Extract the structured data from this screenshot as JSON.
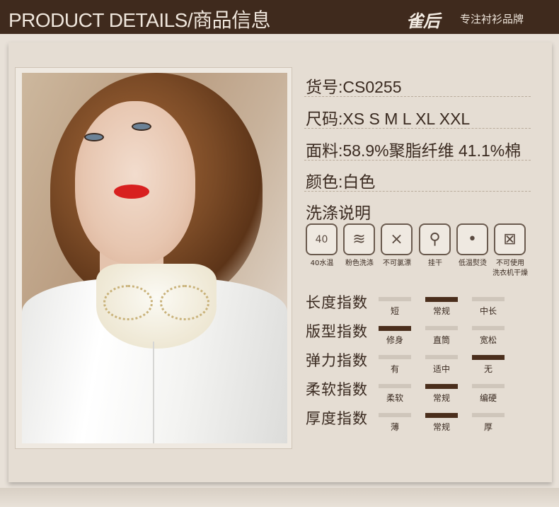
{
  "header": {
    "title": "PRODUCT DETAILS/商品信息",
    "brand": "雀后",
    "slogan": "专注衬衫品牌"
  },
  "specs": {
    "item_no": "货号:CS0255",
    "sizes": "尺码:XS S M L XL XXL",
    "fabric": "面料:58.9%聚脂纤维 41.1%棉",
    "color": "颜色:白色",
    "care_title": "洗涤说明"
  },
  "care": [
    {
      "icon": "wash-40-icon",
      "symbol": "40",
      "label": "40水温"
    },
    {
      "icon": "wash-separately-icon",
      "symbol": "≋",
      "label": "粉色洗涤"
    },
    {
      "icon": "no-bleach-icon",
      "symbol": "⨯",
      "label": "不可氯漂"
    },
    {
      "icon": "hang-dry-icon",
      "symbol": "⚲",
      "label": "挂干"
    },
    {
      "icon": "low-iron-icon",
      "symbol": "•",
      "label": "低温熨烫"
    },
    {
      "icon": "no-tumble-dry-icon",
      "symbol": "⊠",
      "label": "不可使用\n洗衣机干燥"
    }
  ],
  "indices": [
    {
      "title": "长度指数",
      "options": [
        "短",
        "常规",
        "中长"
      ],
      "selected": 1
    },
    {
      "title": "版型指数",
      "options": [
        "修身",
        "直筒",
        "宽松"
      ],
      "selected": 0
    },
    {
      "title": "弹力指数",
      "options": [
        "有",
        "适中",
        "无"
      ],
      "selected": 2
    },
    {
      "title": "柔软指数",
      "options": [
        "柔软",
        "常规",
        "编硬"
      ],
      "selected": 1
    },
    {
      "title": "厚度指数",
      "options": [
        "薄",
        "常规",
        "厚"
      ],
      "selected": 1
    }
  ],
  "colors": {
    "header_bg": "#3f2a1d",
    "selected_bar": "#4a2e1c",
    "unselected_bar": "#cfc6bb",
    "background": "#e5ddd3"
  }
}
